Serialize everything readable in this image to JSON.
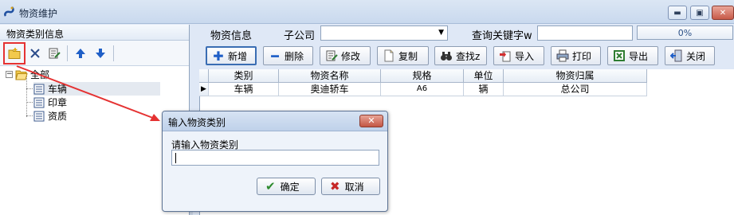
{
  "window": {
    "title": "物资维护",
    "controls": [
      "minimize",
      "restore",
      "close"
    ]
  },
  "left_panel": {
    "header": "物资类别信息",
    "toolbar": [
      {
        "icon": "folder-add-icon",
        "tooltip": ""
      },
      {
        "icon": "delete-icon",
        "tooltip": ""
      },
      {
        "icon": "edit-icon",
        "tooltip": ""
      },
      {
        "icon": "arrow-up-icon",
        "tooltip": ""
      },
      {
        "icon": "arrow-down-icon",
        "tooltip": ""
      }
    ],
    "tree": {
      "root": "全部",
      "children": [
        "车辆",
        "印章",
        "资质"
      ],
      "selected": "车辆"
    }
  },
  "filter_bar": {
    "section_label": "物资信息",
    "company_label": "子公司",
    "company_value": "",
    "keyword_label": "查询关键字w",
    "keyword_value": "",
    "progress": "0%"
  },
  "buttons": {
    "add": "新增",
    "delete": "删除",
    "edit": "修改",
    "copy": "复制",
    "find": "查找z",
    "import": "导入",
    "print": "打印",
    "export": "导出",
    "close": "关闭"
  },
  "grid": {
    "columns": [
      "类别",
      "物资名称",
      "规格",
      "单位",
      "物资归属"
    ],
    "rows": [
      [
        "车辆",
        "奥迪轿车",
        "A6",
        "辆",
        "总公司"
      ]
    ]
  },
  "dialog": {
    "title": "输入物资类别",
    "prompt": "请输入物资类别",
    "input_value": "",
    "ok_label": "确定",
    "cancel_label": "取消"
  },
  "colors": {
    "annotation": "#e53232",
    "accent": "#3a6db3"
  }
}
